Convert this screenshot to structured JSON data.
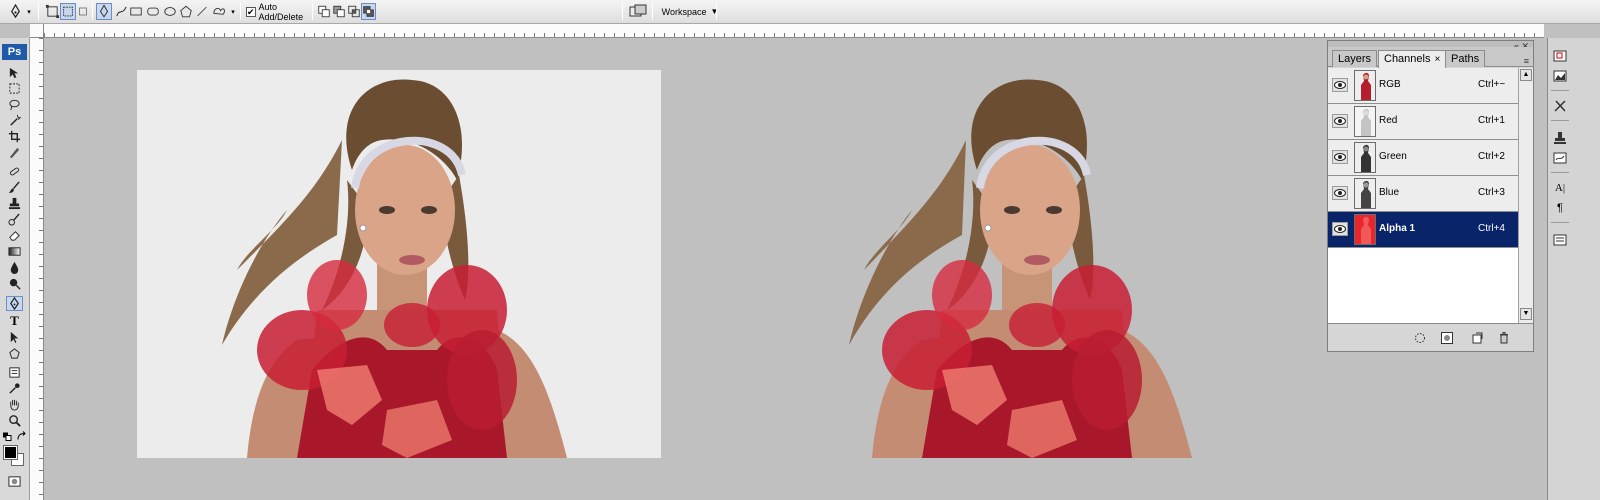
{
  "options_bar": {
    "auto_add_label": "Auto Add/Delete",
    "auto_add_checked": "✔",
    "workspace_label": "Workspace",
    "workspace_arrow": "▼"
  },
  "toolbox": {
    "logo": "Ps",
    "tools": [
      "move-tool",
      "marquee-tool",
      "lasso-tool",
      "magic-wand-tool",
      "crop-tool",
      "slice-tool",
      "healing-tool",
      "brush-tool",
      "clone-stamp-tool",
      "history-brush-tool",
      "eraser-tool",
      "gradient-tool",
      "blur-tool",
      "dodge-tool",
      "pen-tool",
      "type-tool",
      "path-selection-tool",
      "shape-tool",
      "notes-tool",
      "eyedropper-tool",
      "hand-tool",
      "zoom-tool"
    ],
    "type_glyph": "T",
    "selected_tool": "pen-tool"
  },
  "panel": {
    "tabs": [
      {
        "label": "Layers",
        "active": false
      },
      {
        "label": "Channels",
        "active": true
      },
      {
        "label": "Paths",
        "active": false
      }
    ],
    "tab_close": "×",
    "window_controls": "« ✕",
    "menu_glyph": "≡",
    "channels": [
      {
        "name": "RGB",
        "shortcut": "Ctrl+~",
        "selected": false
      },
      {
        "name": "Red",
        "shortcut": "Ctrl+1",
        "selected": false
      },
      {
        "name": "Green",
        "shortcut": "Ctrl+2",
        "selected": false
      },
      {
        "name": "Blue",
        "shortcut": "Ctrl+3",
        "selected": false
      },
      {
        "name": "Alpha 1",
        "shortcut": "Ctrl+4",
        "selected": true
      }
    ],
    "scroll_up": "▲",
    "scroll_down": "▼"
  },
  "right_dock": {
    "character_glyph": "A|",
    "paragraph_glyph": "¶"
  },
  "colors": {
    "foreground": "#000000",
    "background": "#ffffff",
    "selection": "#0a246a",
    "alpha_thumb": "#e8262c"
  }
}
